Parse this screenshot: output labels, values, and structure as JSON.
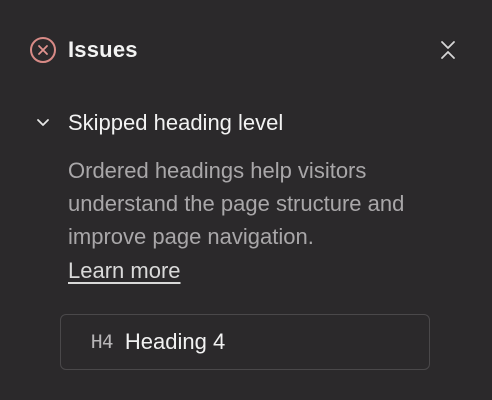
{
  "panel": {
    "title": "Issues",
    "status_icon": "x-circle-icon",
    "status_color": "#d88a86",
    "collapse_icon": "collapse-vertical-icon"
  },
  "issue": {
    "title": "Skipped heading level",
    "expanded": true,
    "chevron_icon": "chevron-down-icon",
    "description": "Ordered headings help visitors understand the page structure and improve page navigation.",
    "learn_more_label": "Learn more",
    "element": {
      "tag": "H4",
      "label": "Heading 4"
    }
  },
  "colors": {
    "background": "#2b292b",
    "text_primary": "#f2f2f2",
    "text_secondary": "#a9a7a9",
    "border": "#4a484a"
  }
}
